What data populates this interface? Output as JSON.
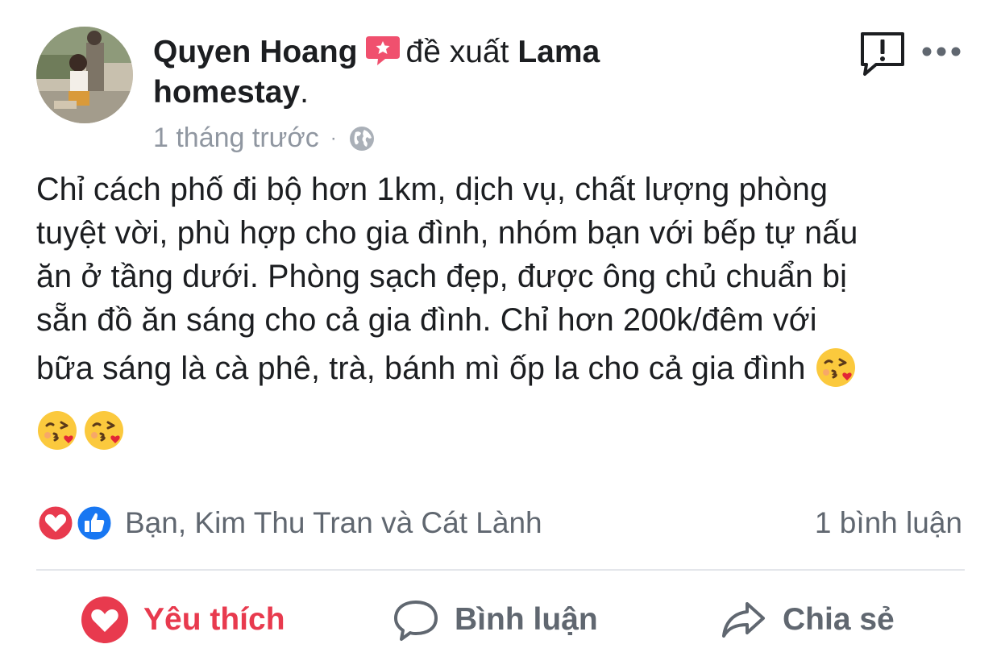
{
  "post": {
    "author": "Quyen Hoang",
    "verb": "đề xuất",
    "page_name_line1": "Lama",
    "page_name_line2": "homestay",
    "period": ".",
    "time": "1 tháng trước",
    "dot": "·",
    "privacy_icon": "globe-icon",
    "body_lines": [
      "Chỉ cách phố đi bộ hơn 1km, dịch vụ, chất lượng phòng",
      "tuyệt vời, phù hợp cho gia đình, nhóm bạn với bếp tự nấu",
      "ăn ở tầng dưới. Phòng sạch đẹp, được ông chủ chuẩn bị",
      "sẵn đồ ăn sáng cho cả gia đình. Chỉ hơn 200k/đêm với",
      "bữa sáng là cà phê, trà, bánh mì ốp la cho cả gia đình"
    ],
    "emoji": "face-blowing-a-kiss"
  },
  "reactions": {
    "icons": [
      "love-reaction",
      "like-reaction"
    ],
    "text": "Bạn, Kim Thu Tran và Cát Lành",
    "comment_count": "1 bình luận"
  },
  "actions": {
    "like_label": "Yêu thích",
    "comment_label": "Bình luận",
    "share_label": "Chia sẻ"
  },
  "colors": {
    "love": "#e83a4e",
    "like_blue": "#1877f2",
    "recommend_badge": "#f0506e",
    "muted_text": "#606770"
  }
}
